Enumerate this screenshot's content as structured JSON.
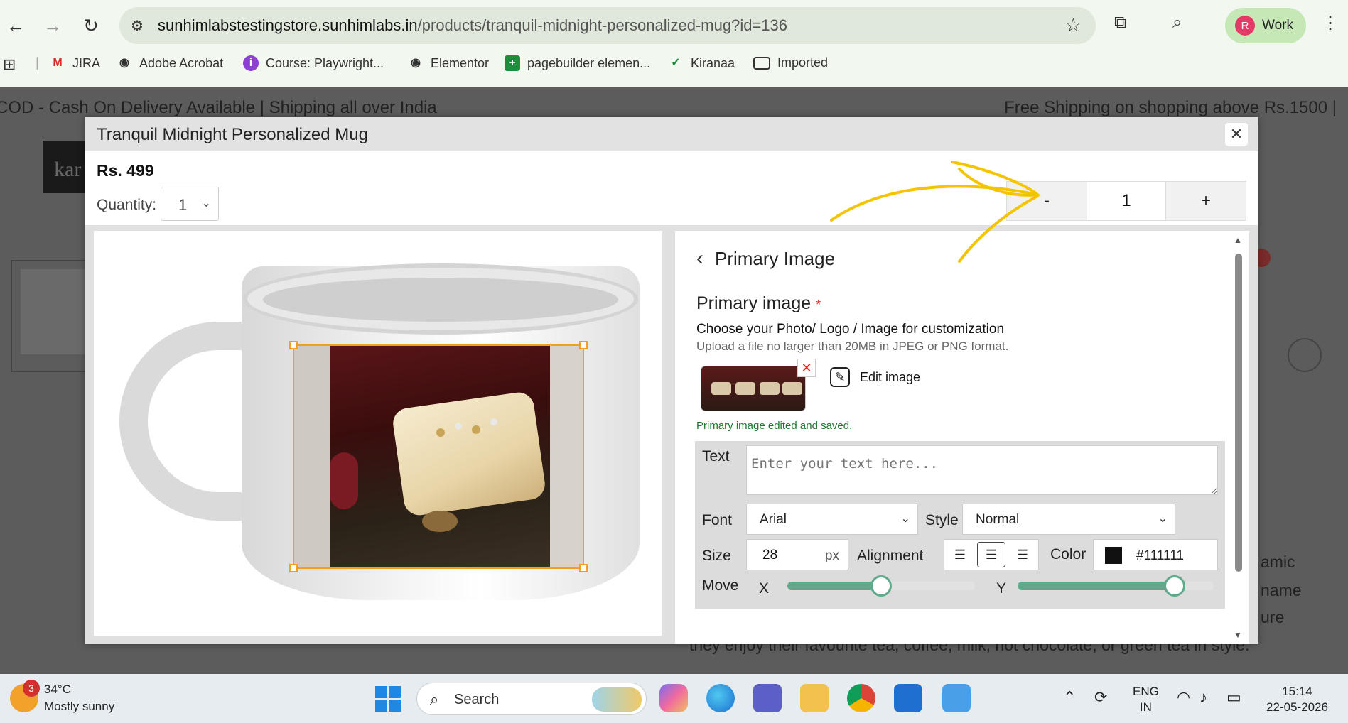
{
  "browser": {
    "url_host": "sunhimlabstestingstore.sunhimlabs.in",
    "url_path": "/products/tranquil-midnight-personalized-mug?id=136",
    "profile_initial": "R",
    "profile_label": "Work",
    "bookmarks": [
      {
        "label": "JIRA",
        "icon": "gmail-icon",
        "color": "#d93025"
      },
      {
        "label": "Adobe Acrobat",
        "icon": "globe-icon",
        "color": "#333333"
      },
      {
        "label": "Course: Playwright...",
        "icon": "course-icon",
        "color": "#8e3fd6"
      },
      {
        "label": "Elementor",
        "icon": "globe-icon",
        "color": "#333333"
      },
      {
        "label": "pagebuilder elemen...",
        "icon": "sheets-icon",
        "color": "#1e8e3e"
      },
      {
        "label": "Kiranaa",
        "icon": "check-circle-icon",
        "color": "#1e8e3e"
      },
      {
        "label": "Imported",
        "icon": "folder-icon",
        "color": "#333333"
      }
    ]
  },
  "page": {
    "ticker_left": "COD - Cash On Delivery Available | Shipping all over India",
    "ticker_right": "Free Shipping on shopping above Rs.1500 |",
    "logo_text": "kar",
    "body_lines": [
      "amic",
      "name",
      "ure",
      "they enjoy their favourite tea, coffee, milk, hot chocolate, or green tea in style."
    ]
  },
  "modal": {
    "title": "Tranquil Midnight Personalized Mug",
    "price": "Rs. 499",
    "quantity_label": "Quantity:",
    "quantity_value": "1",
    "stepper": {
      "minus": "-",
      "value": "1",
      "plus": "+"
    },
    "close_symbol": "✕"
  },
  "editor": {
    "back_title": "Primary Image",
    "heading": "Primary image",
    "required_mark": "*",
    "subheading": "Choose your Photo/ Logo / Image for customization",
    "note": "Upload a file no larger than 20MB in JPEG or PNG format.",
    "edit_label": "Edit image",
    "saved_message": "Primary image edited and saved.",
    "text_label": "Text",
    "text_placeholder": "Enter your text here...",
    "font_label": "Font",
    "font_value": "Arial",
    "style_label": "Style",
    "style_value": "Normal",
    "size_label": "Size",
    "size_value": "28",
    "size_unit": "px",
    "alignment_label": "Alignment",
    "alignment_active": "center",
    "color_label": "Color",
    "color_value": "#111111",
    "move_label": "Move",
    "x_label": "X",
    "y_label": "Y",
    "move_x_fraction": 0.5,
    "move_y_fraction": 0.8
  },
  "taskbar": {
    "temperature": "34°C",
    "weather": "Mostly sunny",
    "weather_badge": "3",
    "search_label": "Search",
    "lang_top": "ENG",
    "lang_bottom": "IN",
    "time": "15:14",
    "date": "22-05-2026"
  },
  "colors": {
    "accent_green": "#5faa8a",
    "selection_orange": "#f0a020",
    "annotation_yellow": "#f5c400"
  }
}
